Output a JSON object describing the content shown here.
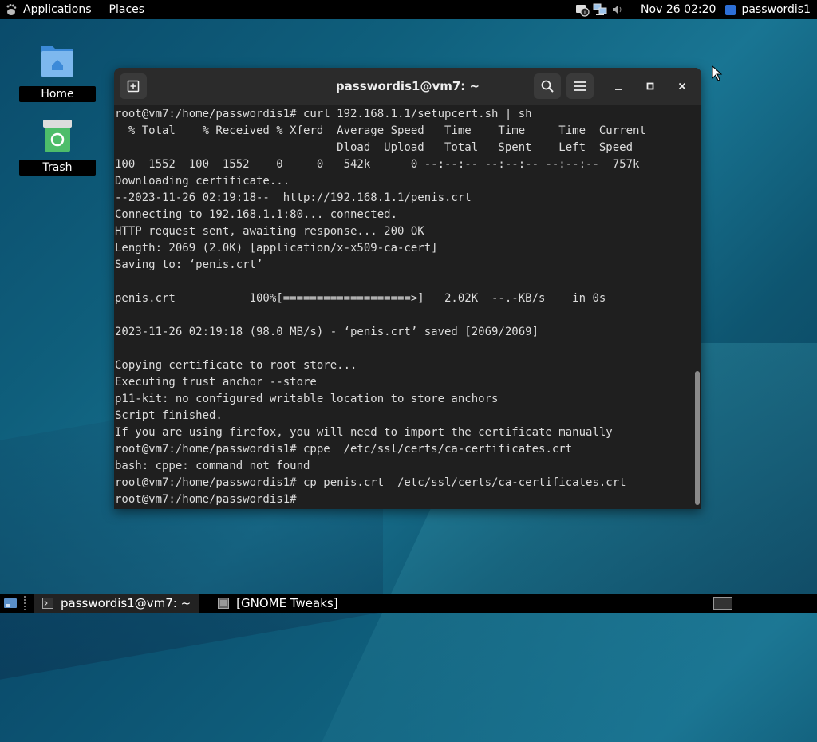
{
  "topbar": {
    "applications": "Applications",
    "places": "Places",
    "clock": "Nov 26 02:20",
    "user": "passwordis1"
  },
  "desktop": {
    "icons": [
      {
        "label": "Home",
        "icon": "folder-home-icon"
      },
      {
        "label": "Trash",
        "icon": "trash-icon"
      }
    ]
  },
  "terminal": {
    "title": "passwordis1@vm7: ~",
    "lines": [
      "root@vm7:/home/passwordis1# curl 192.168.1.1/setupcert.sh | sh",
      "  % Total    % Received % Xferd  Average Speed   Time    Time     Time  Current",
      "                                 Dload  Upload   Total   Spent    Left  Speed",
      "100  1552  100  1552    0     0   542k      0 --:--:-- --:--:-- --:--:--  757k",
      "Downloading certificate...",
      "--2023-11-26 02:19:18--  http://192.168.1.1/penis.crt",
      "Connecting to 192.168.1.1:80... connected.",
      "HTTP request sent, awaiting response... 200 OK",
      "Length: 2069 (2.0K) [application/x-x509-ca-cert]",
      "Saving to: ‘penis.crt’",
      "",
      "penis.crt           100%[===================>]   2.02K  --.-KB/s    in 0s",
      "",
      "2023-11-26 02:19:18 (98.0 MB/s) - ‘penis.crt’ saved [2069/2069]",
      "",
      "Copying certificate to root store...",
      "Executing trust anchor --store",
      "p11-kit: no configured writable location to store anchors",
      "Script finished.",
      "If you are using firefox, you will need to import the certificate manually",
      "root@vm7:/home/passwordis1# cppe  /etc/ssl/certs/ca-certificates.crt",
      "bash: cppe: command not found",
      "root@vm7:/home/passwordis1# cp penis.crt  /etc/ssl/certs/ca-certificates.crt",
      "root@vm7:/home/passwordis1# "
    ]
  },
  "taskbar": {
    "items": [
      {
        "label": "passwordis1@vm7: ~",
        "active": true
      },
      {
        "label": "[GNOME Tweaks]",
        "active": false
      }
    ]
  },
  "colors": {
    "accent": "#2d6fd6",
    "terminal_bg": "#1f1f1f",
    "terminal_fg": "#dcdcdc"
  }
}
